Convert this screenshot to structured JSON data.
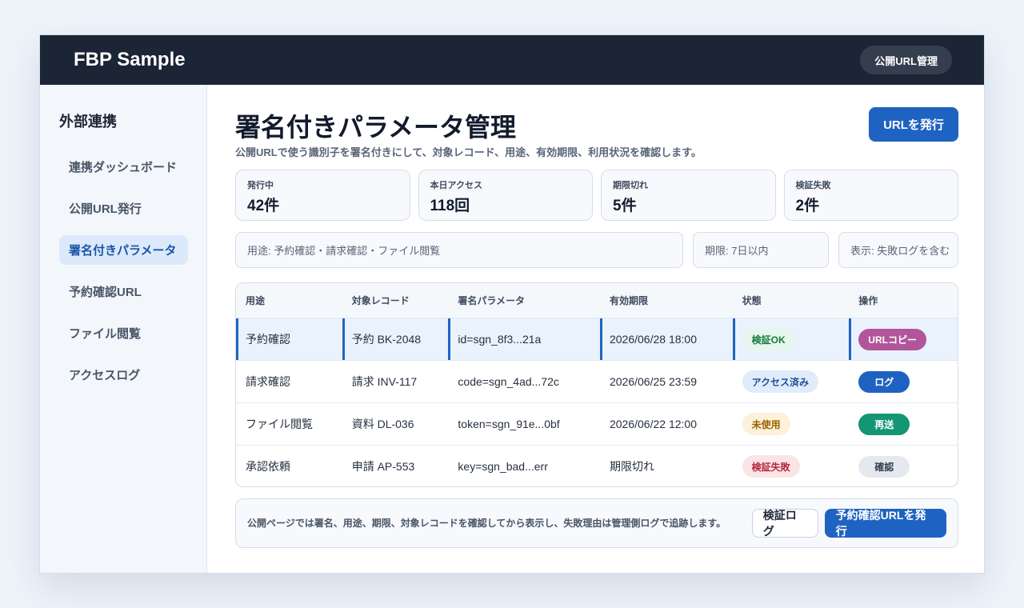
{
  "app": {
    "brand": "FBP Sample",
    "top_button": "公開URL管理"
  },
  "sidebar": {
    "title": "外部連携",
    "items": [
      {
        "label": "連携ダッシュボード",
        "active": false
      },
      {
        "label": "公開URL発行",
        "active": false
      },
      {
        "label": "署名付きパラメータ",
        "active": true
      },
      {
        "label": "予約確認URL",
        "active": false
      },
      {
        "label": "ファイル閲覧",
        "active": false
      },
      {
        "label": "アクセスログ",
        "active": false
      }
    ]
  },
  "main": {
    "title": "署名付きパラメータ管理",
    "subtitle": "公開URLで使う識別子を署名付きにして、対象レコード、用途、有効期限、利用状況を確認します。",
    "issue_button": "URLを発行",
    "stats": [
      {
        "label": "発行中",
        "value": "42件"
      },
      {
        "label": "本日アクセス",
        "value": "118回"
      },
      {
        "label": "期限切れ",
        "value": "5件"
      },
      {
        "label": "検証失敗",
        "value": "2件"
      }
    ],
    "filters": {
      "purpose": "用途: 予約確認・請求確認・ファイル閲覧",
      "period": "期限: 7日以内",
      "display": "表示: 失敗ログを含む"
    },
    "table": {
      "headers": [
        "用途",
        "対象レコード",
        "署名パラメータ",
        "有効期限",
        "状態",
        "操作"
      ],
      "rows": [
        {
          "purpose": "予約確認",
          "record": "予約 BK-2048",
          "param": "id=sgn_8f3...21a",
          "expires": "2026/06/28 18:00",
          "status": "検証OK",
          "action": "URLコピー"
        },
        {
          "purpose": "請求確認",
          "record": "請求 INV-117",
          "param": "code=sgn_4ad...72c",
          "expires": "2026/06/25 23:59",
          "status": "アクセス済み",
          "action": "ログ"
        },
        {
          "purpose": "ファイル閲覧",
          "record": "資料 DL-036",
          "param": "token=sgn_91e...0bf",
          "expires": "2026/06/22 12:00",
          "status": "未使用",
          "action": "再送"
        },
        {
          "purpose": "承認依頼",
          "record": "申請 AP-553",
          "param": "key=sgn_bad...err",
          "expires": "期限切れ",
          "status": "検証失敗",
          "action": "確認"
        }
      ]
    },
    "footer": {
      "note": "公開ページでは署名、用途、期限、対象レコードを確認してから表示し、失敗理由は管理側ログで追跡します。",
      "log_button": "検証ログ",
      "issue_button": "予約確認URLを発行"
    }
  },
  "colors": {
    "topbar": "#1c2536",
    "accent": "#1f63c2",
    "status_ok": "#1b7a3e",
    "status_accessed": "#1f4f98",
    "status_unused": "#9a6200",
    "status_failed": "#b3263b",
    "action_copy": "#b1569a",
    "action_resend": "#139674"
  }
}
